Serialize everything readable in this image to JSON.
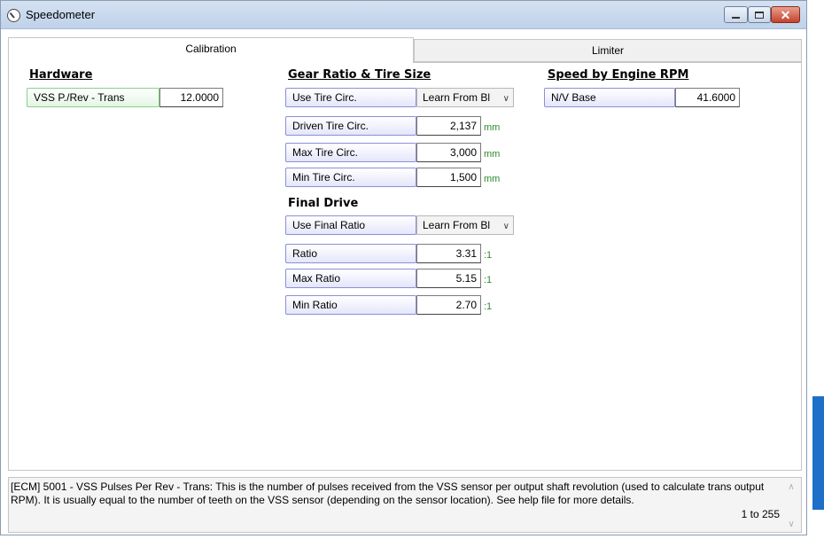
{
  "window": {
    "title": "Speedometer",
    "close_glyph": "✕"
  },
  "tabs": [
    {
      "label": "Calibration",
      "active": true
    },
    {
      "label": "Limiter",
      "active": false
    }
  ],
  "hardware": {
    "heading": "Hardware",
    "vss_label": "VSS P./Rev - Trans",
    "vss_value": "12.0000"
  },
  "gear": {
    "heading": "Gear Ratio & Tire Size",
    "use_tire_label": "Use Tire Circ.",
    "use_tire_value": "Learn From Bl",
    "driven_label": "Driven Tire Circ.",
    "driven_value": "2,137",
    "driven_unit": "mm",
    "max_label": "Max Tire Circ.",
    "max_value": "3,000",
    "max_unit": "mm",
    "min_label": "Min Tire Circ.",
    "min_value": "1,500",
    "min_unit": "mm"
  },
  "final_drive": {
    "heading": "Final Drive",
    "use_label": "Use Final Ratio",
    "use_value": "Learn From Bl",
    "ratio_label": "Ratio",
    "ratio_value": "3.31",
    "ratio_unit": ":1",
    "max_label": "Max Ratio",
    "max_value": "5.15",
    "max_unit": ":1",
    "min_label": "Min Ratio",
    "min_value": "2.70",
    "min_unit": ":1"
  },
  "engine_rpm": {
    "heading": "Speed by Engine RPM",
    "nv_label": "N/V Base",
    "nv_value": "41.6000"
  },
  "help": {
    "text": "[ECM] 5001 - VSS Pulses Per Rev - Trans: This is the number of pulses received from the VSS sensor per output shaft revolution (used to calculate trans output RPM). It is usually equal to the number of teeth on the VSS sensor (depending on the sensor location). See help file for more details.",
    "range": "1 to 255"
  },
  "icons": {
    "chevron": "∨",
    "scroll_up": "∧",
    "scroll_down": "∨"
  },
  "colors": {
    "label_border": "#8c8fd6",
    "label_border_active": "#8ad08a",
    "unit_text": "#2e8b2e",
    "title_bar": "#c9d8ee",
    "close_button": "#c4432b"
  }
}
